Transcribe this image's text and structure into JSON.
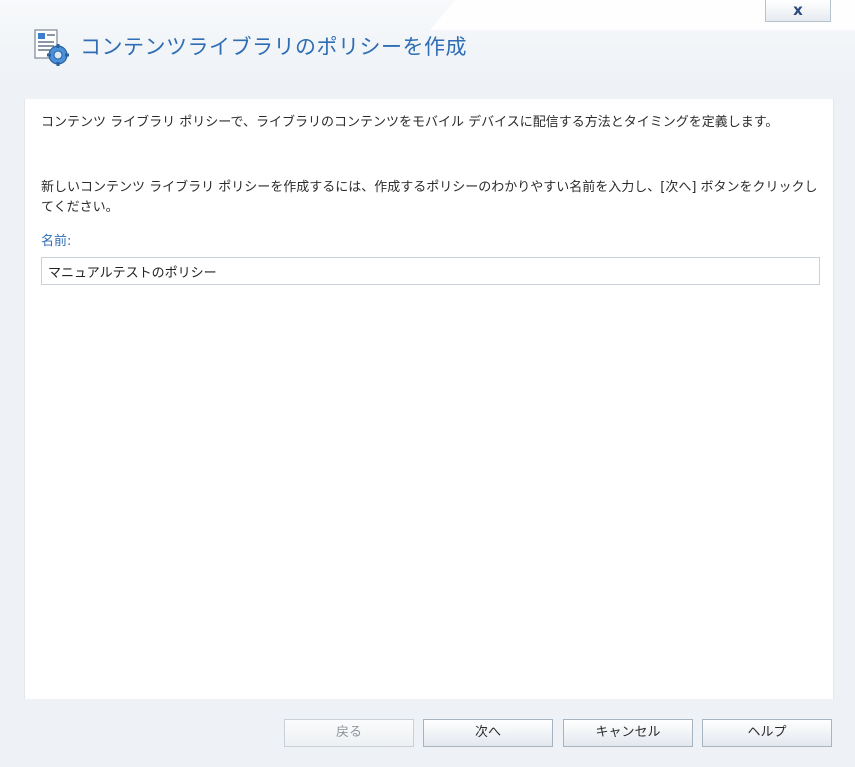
{
  "dialog": {
    "title": "コンテンツライブラリのポリシーを作成",
    "close_label": "x"
  },
  "content": {
    "description": "コンテンツ ライブラリ ポリシーで、ライブラリのコンテンツをモバイル デバイスに配信する方法とタイミングを定義します。",
    "instruction": "新しいコンテンツ ライブラリ ポリシーを作成するには、作成するポリシーのわかりやすい名前を入力し、[次へ] ボタンをクリックしてください。",
    "name_label": "名前:",
    "name_value": "マニュアルテストのポリシー"
  },
  "footer": {
    "back_label": "戻る",
    "next_label": "次へ",
    "cancel_label": "キャンセル",
    "help_label": "ヘルプ"
  },
  "colors": {
    "title": "#2f6db5",
    "label": "#2f6db5"
  },
  "icons": {
    "title_icon": "document-gear-icon"
  }
}
